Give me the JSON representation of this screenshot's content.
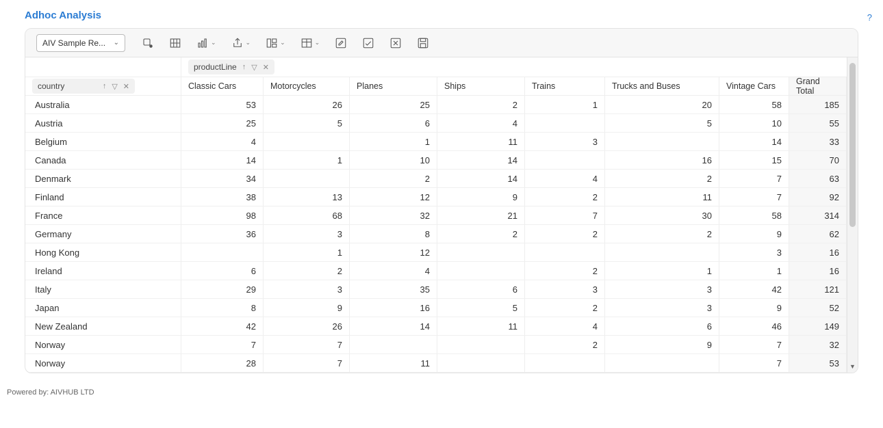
{
  "title": "Adhoc Analysis",
  "help_glyph": "?",
  "toolbar": {
    "source_label": "AIV Sample Re..."
  },
  "col_field": {
    "label": "productLine"
  },
  "row_field": {
    "label": "country"
  },
  "columns": [
    "Classic Cars",
    "Motorcycles",
    "Planes",
    "Ships",
    "Trains",
    "Trucks and Buses",
    "Vintage Cars",
    "Grand Total"
  ],
  "rows": [
    {
      "name": "Australia",
      "v": [
        "53",
        "26",
        "25",
        "2",
        "1",
        "20",
        "58",
        "185"
      ]
    },
    {
      "name": "Austria",
      "v": [
        "25",
        "5",
        "6",
        "4",
        "",
        "5",
        "10",
        "55"
      ]
    },
    {
      "name": "Belgium",
      "v": [
        "4",
        "",
        "1",
        "11",
        "3",
        "",
        "14",
        "33"
      ]
    },
    {
      "name": "Canada",
      "v": [
        "14",
        "1",
        "10",
        "14",
        "",
        "16",
        "15",
        "70"
      ]
    },
    {
      "name": "Denmark",
      "v": [
        "34",
        "",
        "2",
        "14",
        "4",
        "2",
        "7",
        "63"
      ]
    },
    {
      "name": "Finland",
      "v": [
        "38",
        "13",
        "12",
        "9",
        "2",
        "11",
        "7",
        "92"
      ]
    },
    {
      "name": "France",
      "v": [
        "98",
        "68",
        "32",
        "21",
        "7",
        "30",
        "58",
        "314"
      ]
    },
    {
      "name": "Germany",
      "v": [
        "36",
        "3",
        "8",
        "2",
        "2",
        "2",
        "9",
        "62"
      ]
    },
    {
      "name": "Hong Kong",
      "v": [
        "",
        "1",
        "12",
        "",
        "",
        "",
        "3",
        "16"
      ]
    },
    {
      "name": "Ireland",
      "v": [
        "6",
        "2",
        "4",
        "",
        "2",
        "1",
        "1",
        "16"
      ]
    },
    {
      "name": "Italy",
      "v": [
        "29",
        "3",
        "35",
        "6",
        "3",
        "3",
        "42",
        "121"
      ]
    },
    {
      "name": "Japan",
      "v": [
        "8",
        "9",
        "16",
        "5",
        "2",
        "3",
        "9",
        "52"
      ]
    },
    {
      "name": "New Zealand",
      "v": [
        "42",
        "26",
        "14",
        "11",
        "4",
        "6",
        "46",
        "149"
      ]
    },
    {
      "name": "Norway",
      "v": [
        "7",
        "7",
        "",
        "",
        "2",
        "9",
        "7",
        "32"
      ]
    },
    {
      "name": "Norway",
      "v": [
        "28",
        "7",
        "11",
        "",
        "",
        "",
        "7",
        "53"
      ]
    }
  ],
  "footer": "Powered by: AIVHUB LTD"
}
